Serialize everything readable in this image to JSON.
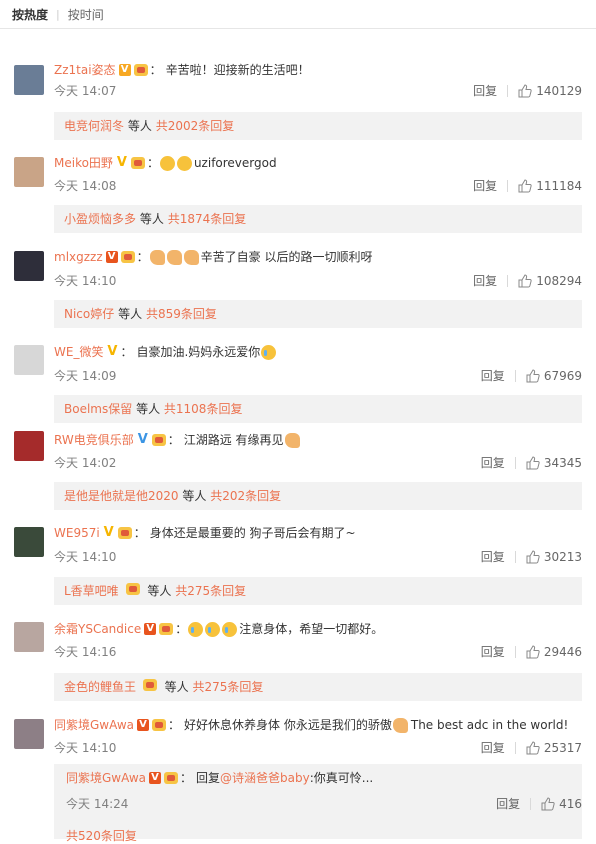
{
  "tabs": {
    "hot": "按热度",
    "time": "按时间"
  },
  "labels": {
    "reply": "回复",
    "colon": "：",
    "etc": "等人"
  },
  "comments": [
    {
      "user": "Zz1tai姿态",
      "vbadge": "orange",
      "text": "辛苦啦！迎接新的生活吧！",
      "time": "今天 14:07",
      "likes": "140129",
      "thread_user": "电竞何润冬",
      "thread_count": "共2002条回复",
      "avatar_color": "#6a7d96"
    },
    {
      "user": "Meiko田野",
      "vbadge": "yellow",
      "text": "uziforevergod",
      "time": "今天 14:08",
      "likes": "111184",
      "thread_user": "小盈烦恼多多",
      "thread_count": "共1874条回复",
      "avatar_color": "#c9a487"
    },
    {
      "user": "mlxgzzz",
      "vbadge": "red",
      "text": "辛苦了自豪 以后的路一切顺利呀",
      "time": "今天 14:10",
      "likes": "108294",
      "thread_user": "Nico婷仔",
      "thread_count": "共859条回复",
      "avatar_color": "#2e2e3a"
    },
    {
      "user": "WE_微笑",
      "vbadge": "yellow",
      "text": "自豪加油.妈妈永远爱你",
      "time": "今天 14:09",
      "likes": "67969",
      "thread_user": "Boelms保留",
      "thread_count": "共1108条回复",
      "avatar_color": "#d7d7d7"
    },
    {
      "user": "RW电竞俱乐部",
      "vbadge": "blue",
      "text": "江湖路远 有缘再见",
      "time": "今天 14:02",
      "likes": "34345",
      "thread_user": "是他是他就是他2020",
      "thread_count": "共202条回复",
      "avatar_color": "#a52b2b"
    },
    {
      "user": "WE957i",
      "vbadge": "yellow",
      "text": "身体还是最重要的 狗子哥后会有期了~",
      "time": "今天 14:10",
      "likes": "30213",
      "thread_user": "L香草吧唯",
      "thread_count": "共275条回复",
      "avatar_color": "#3a4a3a"
    },
    {
      "user": "余霜YSCandice",
      "vbadge": "red",
      "text": "注意身体，希望一切都好。",
      "time": "今天 14:16",
      "likes": "29446",
      "thread_user": "金色的鲤鱼王",
      "thread_count": "共275条回复",
      "avatar_color": "#b8a6a0"
    },
    {
      "user": "同紫境GwAwa",
      "vbadge": "red",
      "text": "好好休息休养身体 你永远是我们的骄傲",
      "text_en": "The best adc in the world!",
      "time": "今天 14:10",
      "likes": "25317",
      "avatar_color": "#8d7f86"
    }
  ],
  "subreply": {
    "user": "同紫境GwAwa",
    "reply_word": "回复",
    "mention": "@诗涵爸爸baby",
    "text": ":你真可怜...",
    "time": "今天 14:24",
    "likes": "416"
  },
  "footer": {
    "count": "共520条回复"
  }
}
